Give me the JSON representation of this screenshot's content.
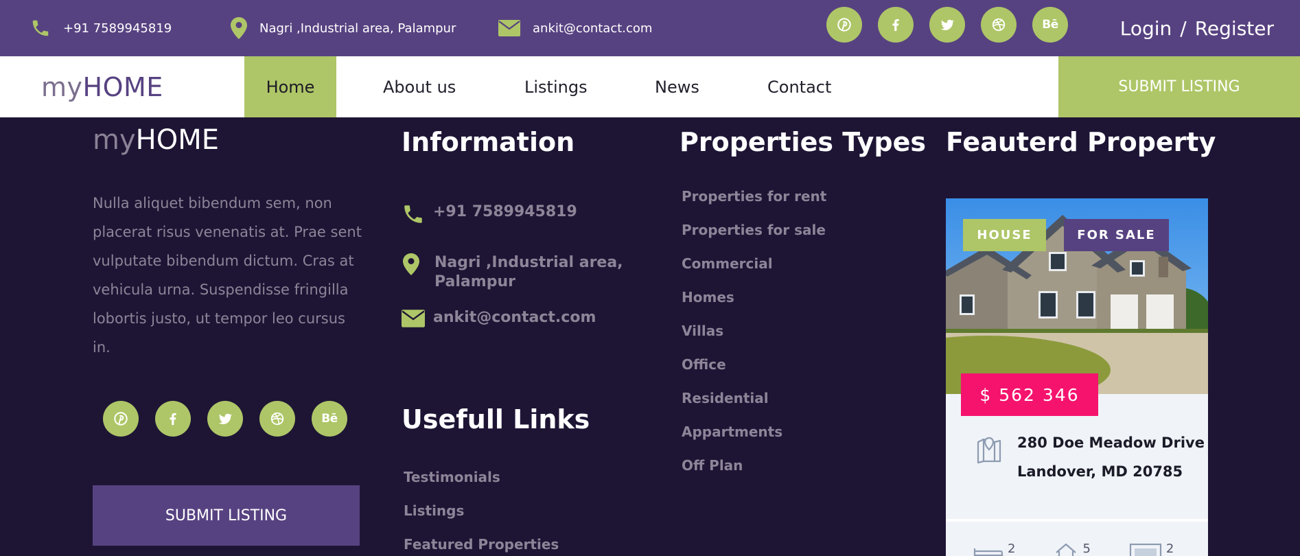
{
  "topbar": {
    "phone": "+91 7589945819",
    "address": "Nagri ,Industrial area, Palampur",
    "email": "ankit@contact.com",
    "login": "Login",
    "separator": "/",
    "register": "Register",
    "socials": [
      "pinterest-icon",
      "facebook-icon",
      "twitter-icon",
      "dribbble-icon",
      "behance-icon"
    ],
    "behance_text": "Bē"
  },
  "nav": {
    "logo_my": "my",
    "logo_home": "HOME",
    "links": [
      "Home",
      "About us",
      "Listings",
      "News",
      "Contact"
    ],
    "active": "Home",
    "submit": "SUBMIT LISTING"
  },
  "footer": {
    "logo_my": "my",
    "logo_home": "HOME",
    "about": "Nulla aliquet bibendum sem, non placerat risus venenatis at. Prae sent vulputate bibendum dictum. Cras at vehicula urna. Suspendisse fringilla lobortis justo, ut tempor leo cursus in.",
    "submit": "SUBMIT LISTING",
    "information": {
      "title": "Information",
      "phone": "+91 7589945819",
      "address": "Nagri ,Industrial area, Palampur",
      "email": "ankit@contact.com"
    },
    "types": {
      "title": "Properties Types",
      "items": [
        "Properties for rent",
        "Properties for sale",
        "Commercial",
        "Homes",
        "Villas",
        "Office",
        "Residential",
        "Appartments",
        "Off Plan"
      ]
    },
    "useful": {
      "title": "Usefull Links",
      "items": [
        "Testimonials",
        "Listings",
        "Featured Properties"
      ]
    },
    "featured": {
      "title": "Feauterd Property",
      "badge_type": "HOUSE",
      "badge_status": "FOR SALE",
      "price": "$ 562 346",
      "address_line1": "280 Doe Meadow Drive",
      "address_line2": "Landover, MD 20785",
      "stats": [
        "2",
        "5",
        "2"
      ]
    }
  },
  "colors": {
    "topbar": "#574281",
    "accent": "#aec667",
    "footer_bg": "#1e1535",
    "price": "#f5136e"
  }
}
